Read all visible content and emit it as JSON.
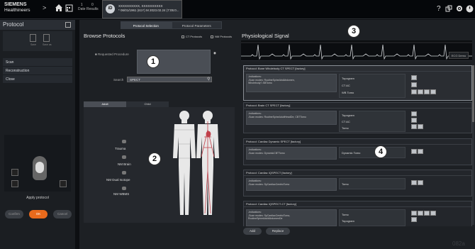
{
  "topbar": {
    "logo_line1": "SIEMENS",
    "logo_line2": "Healthineers",
    "count1": "1",
    "count1_label": "Date",
    "count2": "0",
    "count2_label": "Results",
    "patient_icon": "iD",
    "patient_line1": "XXXXXXXXXX, XXXXXXXXXX",
    "patient_line2": "* 06/01/1961 (61Y) M 2023.02.24 (7:05:0...",
    "help_icon": "?",
    "icons": [
      "home-icon",
      "calendar-icon",
      "layout-icon",
      "gear-icon"
    ]
  },
  "left_panel": {
    "title": "Protocol",
    "icon_labels": [
      "Save",
      "Save as"
    ],
    "menu": [
      "Scan",
      "Reconstruction",
      "Close"
    ],
    "apply_label": "Apply protocol",
    "buttons": {
      "confirm": "Confirm",
      "ok": "OK",
      "cancel": "Cancel"
    }
  },
  "tabs": [
    "Protocol Selection",
    "Protocol Parameters"
  ],
  "browse": {
    "title": "Browse Protocols",
    "ct_label": "CT Protocols",
    "nm_label": "NM Protocols",
    "requested_label": "Requested Procedure",
    "search_label": "Search",
    "search_value": "SPECT",
    "subtabs": [
      "Adult",
      "Child"
    ],
    "body_labels": [
      "Trauma",
      "NM Brain",
      "NM Dual Isotope",
      "NM WBMS"
    ]
  },
  "physio": {
    "title": "Physiological Signal",
    "ecg_label": "ECG Demo"
  },
  "callouts": [
    "1",
    "2",
    "3",
    "4"
  ],
  "protocols": [
    {
      "title": "Protocol: Bone Wholebody CT SPECT [factory]",
      "indications": [
        "-Indications:",
        "-Scan modes: RoutineSpineAbdAbdomen,",
        "Wholebody?-SBTomo"
      ],
      "ops": [
        "Topogram",
        "CT AC",
        "WB Tomo"
      ]
    },
    {
      "title": "Protocol: Brain CT SPECT [factory]",
      "indications": [
        "-Indications:",
        "-Scan modes: RoutineSpineAdultHeadDe, CBTTomo"
      ],
      "ops": [
        "Topogram",
        "CT AC",
        "Tomo"
      ]
    },
    {
      "title": "Protocol: Cardiac Dynamic SPECT [factory]",
      "indications": [
        "-Indications:",
        "-Scan modes: DynamicCBTTomo"
      ],
      "ops": [
        "Dynamic Tomo"
      ]
    },
    {
      "title": "Protocol: Cardiac IQSPECT [factory]",
      "indications": [
        "-Indications:",
        "-Scan modes: SyCardiacCentricTomo"
      ],
      "ops": [
        "Tomo"
      ]
    },
    {
      "title": "Protocol: Cardiac IQSPECT-CT [factory]",
      "indications": [
        "-Indications:",
        "-Scan modes: SyCardiacCentricTomo,",
        "RoutineSpineAdultAbdomenDe"
      ],
      "ops": [
        "Tomo",
        "Topogram"
      ]
    }
  ],
  "bottom_buttons": {
    "add": "Add",
    "replace": "Replace"
  },
  "watermark": "082a"
}
